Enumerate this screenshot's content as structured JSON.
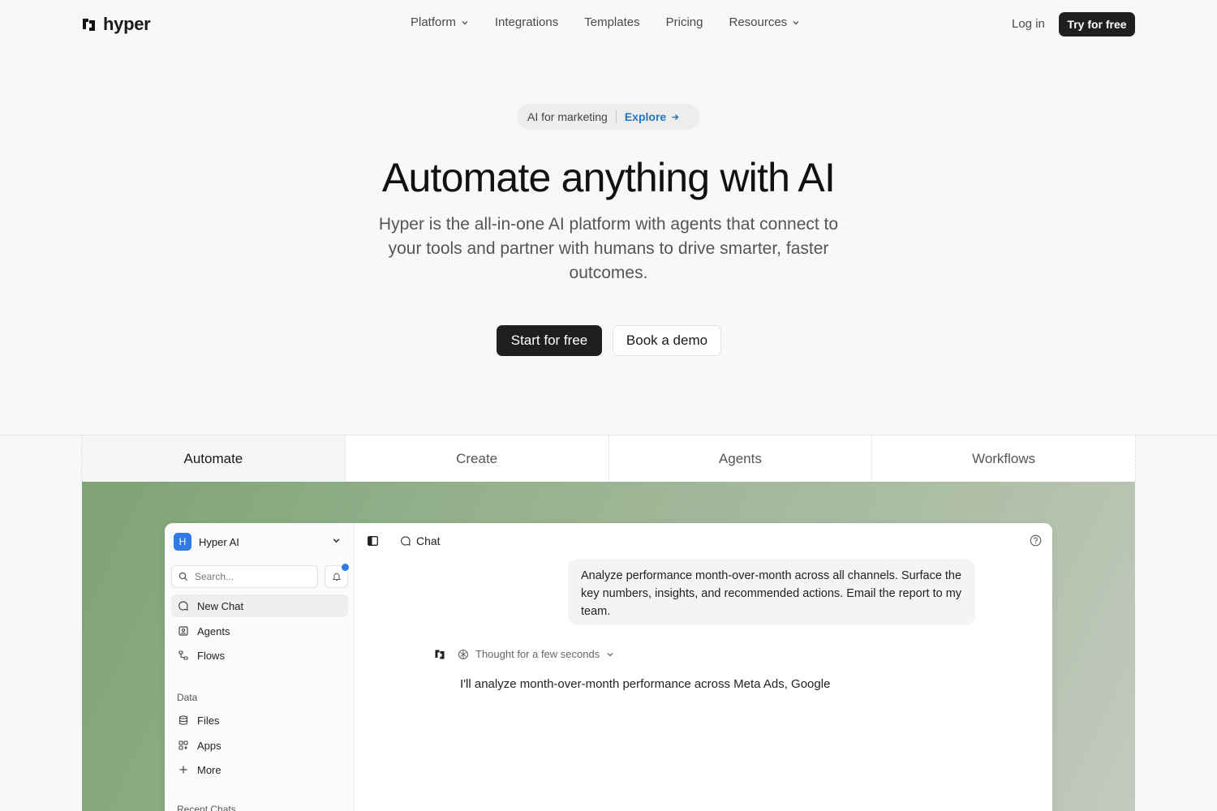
{
  "brand": {
    "name": "hyper"
  },
  "nav": {
    "items": [
      {
        "label": "Platform",
        "dropdown": true
      },
      {
        "label": "Integrations",
        "dropdown": false
      },
      {
        "label": "Templates",
        "dropdown": false
      },
      {
        "label": "Pricing",
        "dropdown": false
      },
      {
        "label": "Resources",
        "dropdown": true
      }
    ],
    "login": "Log in",
    "try": "Try for free"
  },
  "hero": {
    "pill_text": "AI for marketing",
    "pill_link": "Explore",
    "title": "Automate anything with AI",
    "subtitle": "Hyper is the all-in-one AI platform with agents that connect to your tools and partner with humans to drive smarter, faster outcomes.",
    "cta_primary": "Start for free",
    "cta_secondary": "Book a demo"
  },
  "tabs": [
    {
      "label": "Automate",
      "active": true
    },
    {
      "label": "Create",
      "active": false
    },
    {
      "label": "Agents",
      "active": false
    },
    {
      "label": "Workflows",
      "active": false
    }
  ],
  "app": {
    "workspace": {
      "initial": "H",
      "name": "Hyper AI"
    },
    "search_placeholder": "Search...",
    "primary_items": [
      {
        "label": "New Chat",
        "icon": "chat-icon",
        "active": true
      },
      {
        "label": "Agents",
        "icon": "agent-icon",
        "active": false
      },
      {
        "label": "Flows",
        "icon": "flow-icon",
        "active": false
      }
    ],
    "data_group_label": "Data",
    "data_items": [
      {
        "label": "Files",
        "icon": "database-icon"
      },
      {
        "label": "Apps",
        "icon": "apps-icon"
      },
      {
        "label": "More",
        "icon": "plus-icon"
      }
    ],
    "recent_label": "Recent Chats",
    "chat_title": "Chat",
    "user_message": "Analyze performance month-over-month across all channels. Surface the key numbers, insights, and recommended actions. Email the report to my team.",
    "thought_label": "Thought for a few seconds",
    "answer_text": "I'll analyze month-over-month performance across Meta Ads, Google"
  },
  "colors": {
    "accent": "#2f7ae5",
    "link": "#1f76c4",
    "primary_button": "#1f1f1f"
  }
}
